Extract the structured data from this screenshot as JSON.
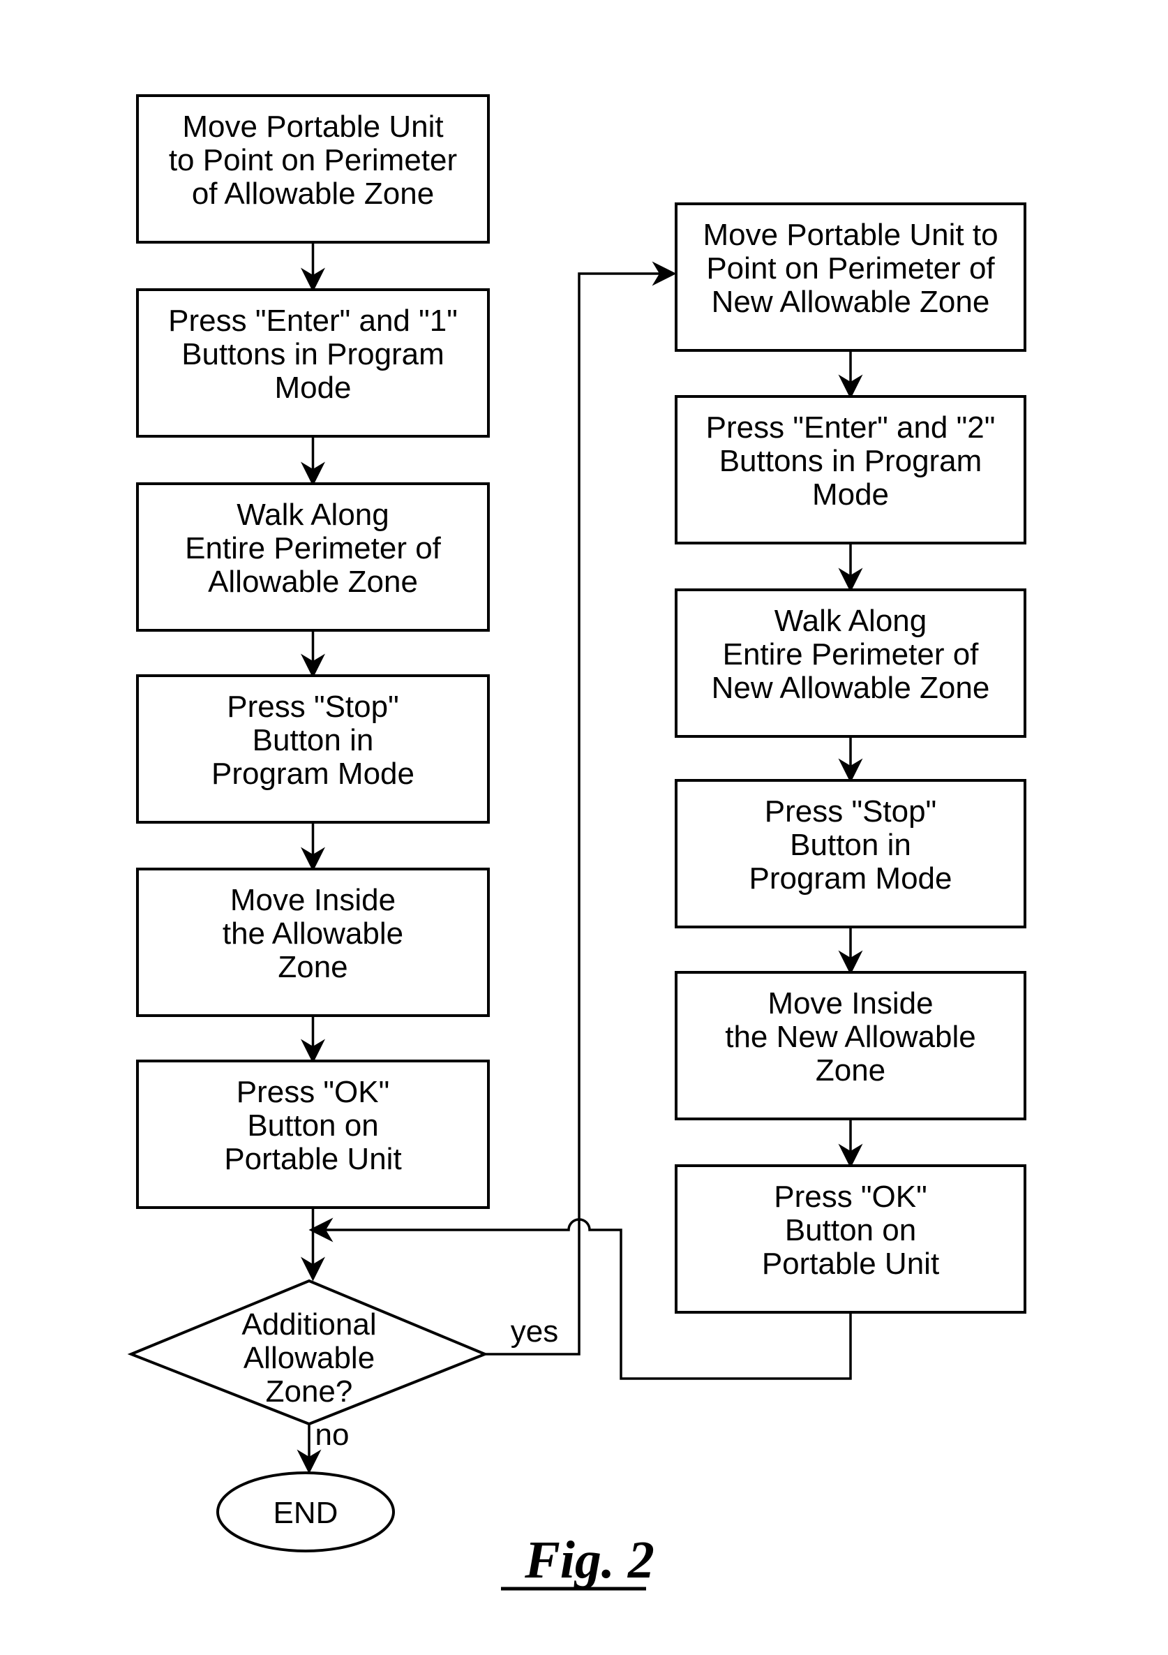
{
  "figure": {
    "caption": "Fig. 2",
    "left_column": [
      {
        "id": "L1",
        "lines": [
          "Move Portable Unit",
          "to Point on Perimeter",
          "of Allowable Zone"
        ]
      },
      {
        "id": "L2",
        "lines": [
          "Press \"Enter\" and \"1\"",
          "Buttons in Program",
          "Mode"
        ]
      },
      {
        "id": "L3",
        "lines": [
          "Walk Along",
          "Entire Perimeter of",
          "Allowable Zone"
        ]
      },
      {
        "id": "L4",
        "lines": [
          "Press \"Stop\"",
          "Button in",
          "Program Mode"
        ]
      },
      {
        "id": "L5",
        "lines": [
          "Move Inside",
          "the Allowable",
          "Zone"
        ]
      },
      {
        "id": "L6",
        "lines": [
          "Press \"OK\"",
          "Button on",
          "Portable Unit"
        ]
      }
    ],
    "right_column": [
      {
        "id": "R1",
        "lines": [
          "Move Portable Unit to",
          "Point on Perimeter of",
          "New Allowable Zone"
        ]
      },
      {
        "id": "R2",
        "lines": [
          "Press \"Enter\" and \"2\"",
          "Buttons in Program",
          "Mode"
        ]
      },
      {
        "id": "R3",
        "lines": [
          "Walk Along",
          "Entire Perimeter of",
          "New Allowable Zone"
        ]
      },
      {
        "id": "R4",
        "lines": [
          "Press \"Stop\"",
          "Button in",
          "Program Mode"
        ]
      },
      {
        "id": "R5",
        "lines": [
          "Move Inside",
          "the New Allowable",
          "Zone"
        ]
      },
      {
        "id": "R6",
        "lines": [
          "Press \"OK\"",
          "Button on",
          "Portable Unit"
        ]
      }
    ],
    "decision": {
      "lines": [
        "Additional",
        "Allowable",
        "Zone?"
      ],
      "yes_label": "yes",
      "no_label": "no"
    },
    "terminal": {
      "label": "END"
    }
  }
}
